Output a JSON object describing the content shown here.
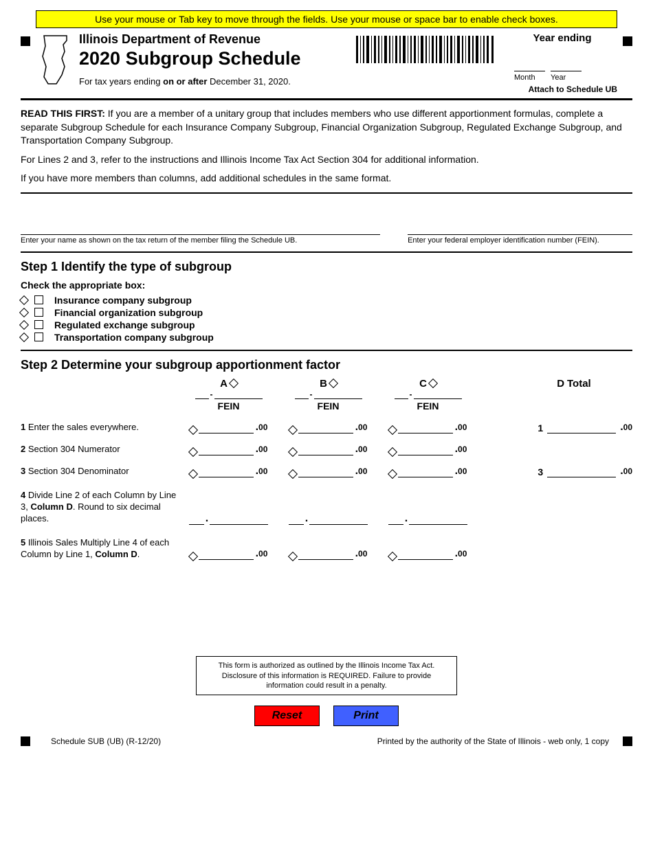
{
  "banner": "Use your mouse or Tab key to move through the fields. Use your mouse or space bar to enable check boxes.",
  "header": {
    "department": "Illinois Department of Revenue",
    "title": "2020 Subgroup Schedule",
    "tax_years_prefix": "For tax years ending ",
    "tax_years_bold": "on or after",
    "tax_years_suffix": " December 31, 2020.",
    "year_ending": "Year ending",
    "month_label": "Month",
    "year_label": "Year",
    "attach": "Attach to Schedule UB"
  },
  "intro": {
    "read_first_label": "READ THIS FIRST:",
    "read_first_text": " If you are a member of a unitary group that includes members who use different apportionment formulas, complete a separate Subgroup Schedule for each Insurance Company Subgroup, Financial Organization Subgroup, Regulated Exchange Subgroup, and Transportation Company Subgroup.",
    "lines23": "For Lines 2 and 3, refer to the instructions and Illinois Income Tax Act Section 304 for additional information.",
    "more_members": "If you have more members than columns, add additional schedules in the same format."
  },
  "identity": {
    "name_label": "Enter your name as shown on the tax return of the member filing the Schedule UB.",
    "fein_label": "Enter your federal employer identification number (FEIN)."
  },
  "step1": {
    "title": "Step 1 Identify the type of subgroup",
    "check_label": "Check the appropriate box:",
    "options": [
      "Insurance company subgroup",
      "Financial organization subgroup",
      "Regulated exchange subgroup",
      "Transportation company subgroup"
    ]
  },
  "step2": {
    "title": "Step 2 Determine your subgroup apportionment factor",
    "cols": {
      "a": "A",
      "b": "B",
      "c": "C",
      "d": "D",
      "total": "Total"
    },
    "fein": "FEIN",
    "lines": {
      "l1_num": "1",
      "l1_text": " Enter the sales everywhere.",
      "l2_num": "2",
      "l2_text": " Section 304 Numerator",
      "l3_num": "3",
      "l3_text": " Section 304 Denominator",
      "l4_num": "4",
      "l4_text_a": " Divide Line 2 of each Column by Line 3, ",
      "l4_text_b": "Column D",
      "l4_text_c": ". Round to six decimal places.",
      "l5_num": "5",
      "l5_text_a": " Illinois Sales Multiply Line 4 of each Column by Line 1, ",
      "l5_text_b": "Column D",
      "l5_text_c": "."
    },
    "cents": "00",
    "total_1": "1",
    "total_3": "3"
  },
  "disclosure": "This form is authorized as outlined by the Illinois Income Tax Act. Disclosure of this information is REQUIRED. Failure to provide information could result in a penalty.",
  "buttons": {
    "reset": "Reset",
    "print": "Print"
  },
  "footer": {
    "left": "Schedule SUB (UB) (R-12/20)",
    "right": "Printed by the authority of the State of Illinois - web only, 1 copy"
  }
}
